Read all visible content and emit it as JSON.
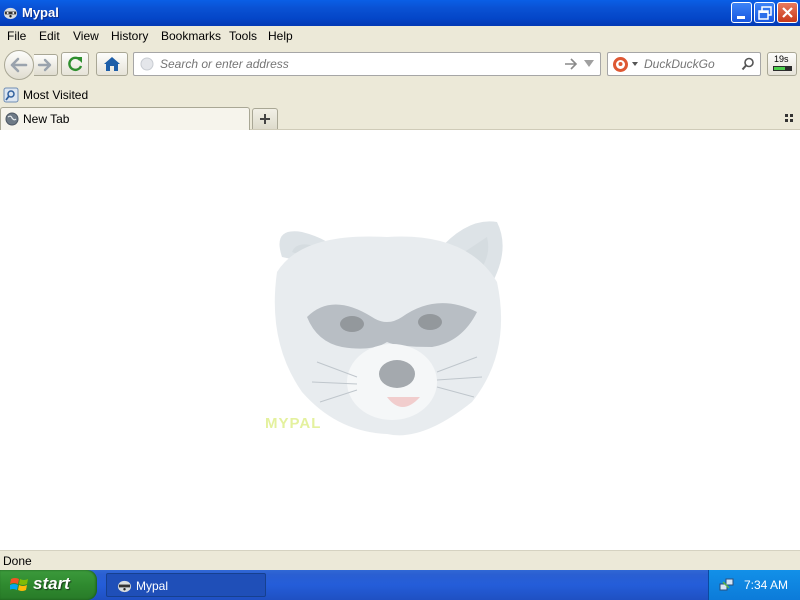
{
  "window": {
    "title": "Mypal"
  },
  "menu": [
    "File",
    "Edit",
    "View",
    "History",
    "Bookmarks",
    "Tools",
    "Help"
  ],
  "urlbar": {
    "placeholder": "Search or enter address"
  },
  "searchbar": {
    "engine": "DuckDuckGo",
    "placeholder": "DuckDuckGo"
  },
  "addon_badge": "19s",
  "bookmarks": {
    "items": [
      {
        "label": "Most Visited"
      }
    ]
  },
  "tabs": [
    {
      "label": "New Tab",
      "active": true
    }
  ],
  "content": {
    "logo_text": "MYPAL"
  },
  "status": {
    "text": "Done"
  },
  "taskbar": {
    "start_label": "start",
    "items": [
      {
        "label": "Mypal"
      }
    ],
    "clock": "7:34 AM"
  },
  "colors": {
    "titlebar": "#0a52d4",
    "chrome": "#ece9d8",
    "taskbar": "#245dd9",
    "start": "#2f8a2f",
    "tray": "#0c7bd9"
  }
}
